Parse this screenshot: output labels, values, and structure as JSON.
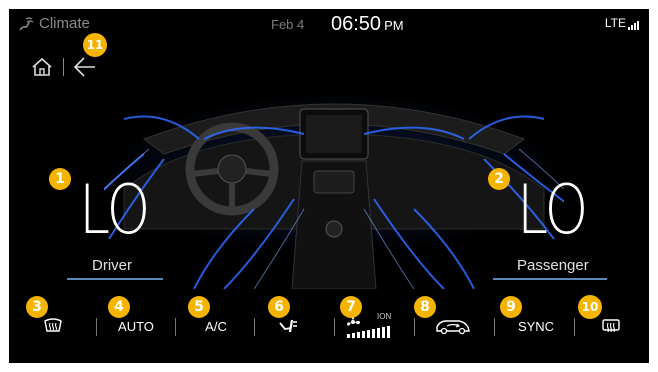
{
  "status_bar": {
    "app_title": "Climate",
    "date": "Feb 4",
    "time": "06:50",
    "ampm": "PM",
    "network": "LTE"
  },
  "climate": {
    "driver": {
      "temperature": "LO",
      "label": "Driver"
    },
    "passenger": {
      "temperature": "LO",
      "label": "Passenger"
    }
  },
  "controls": {
    "auto_label": "AUTO",
    "ac_label": "A/C",
    "sync_label": "SYNC",
    "ion_label": "ION"
  },
  "callouts": [
    "1",
    "2",
    "3",
    "4",
    "5",
    "6",
    "7",
    "8",
    "9",
    "10",
    "11"
  ],
  "colors": {
    "callout": "#f5b400",
    "airflow": "#2f6bff",
    "background": "#000000"
  },
  "icons": [
    "fan-climate-icon",
    "home-icon",
    "back-arrow-icon",
    "front-defrost-icon",
    "airflow-mode-icon",
    "fan-speed-icon",
    "recirculation-icon",
    "rear-defrost-icon",
    "signal-bars-icon"
  ]
}
